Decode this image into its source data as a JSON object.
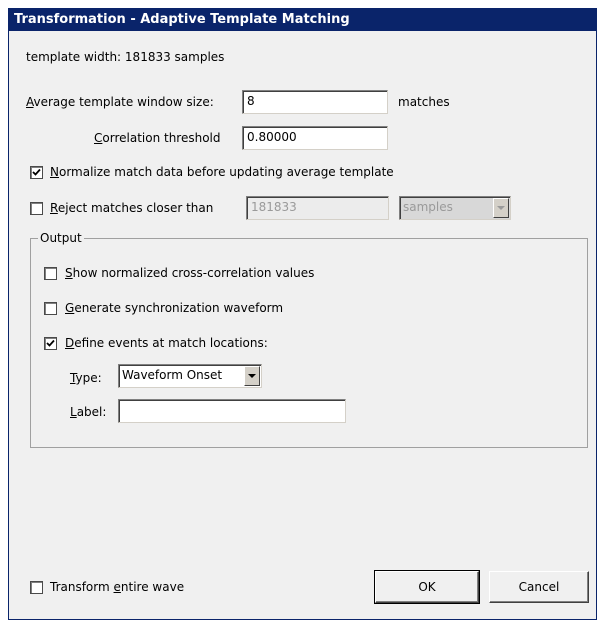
{
  "window": {
    "title": "Transformation - Adaptive Template Matching"
  },
  "template_width": "template width:  181833  samples",
  "avg_window": {
    "label_prefix": "",
    "label_accel": "A",
    "label_rest": "verage template window size:",
    "value": "8",
    "unit": "matches"
  },
  "correlation": {
    "label_accel": "C",
    "label_rest": "orrelation threshold",
    "value": "0.80000"
  },
  "normalize": {
    "checked": true,
    "label_accel": "N",
    "label_rest": "ormalize match data before updating average template"
  },
  "reject": {
    "checked": false,
    "label_accel": "R",
    "label_rest": "eject matches closer than",
    "value": "181833",
    "unit": "samples"
  },
  "output": {
    "title": "Output",
    "show_ncc": {
      "checked": false,
      "label_accel": "S",
      "label_rest": "how normalized cross-correlation values"
    },
    "sync_wave": {
      "checked": false,
      "label_accel": "G",
      "label_rest": "enerate synchronization waveform"
    },
    "define_events": {
      "checked": true,
      "label_accel": "D",
      "label_rest": "efine events at match  locations:"
    },
    "type": {
      "label_accel": "T",
      "label_rest": "ype:",
      "value": "Waveform Onset"
    },
    "label": {
      "label_accel": "L",
      "label_rest": "abel:",
      "value": ""
    }
  },
  "transform_entire": {
    "checked": false,
    "label_prefix": "Transform ",
    "label_accel": "e",
    "label_rest": "ntire wave"
  },
  "buttons": {
    "ok": "OK",
    "cancel": "Cancel"
  },
  "colors": {
    "titlebar": "#0a246a",
    "face": "#f0f0f0"
  }
}
